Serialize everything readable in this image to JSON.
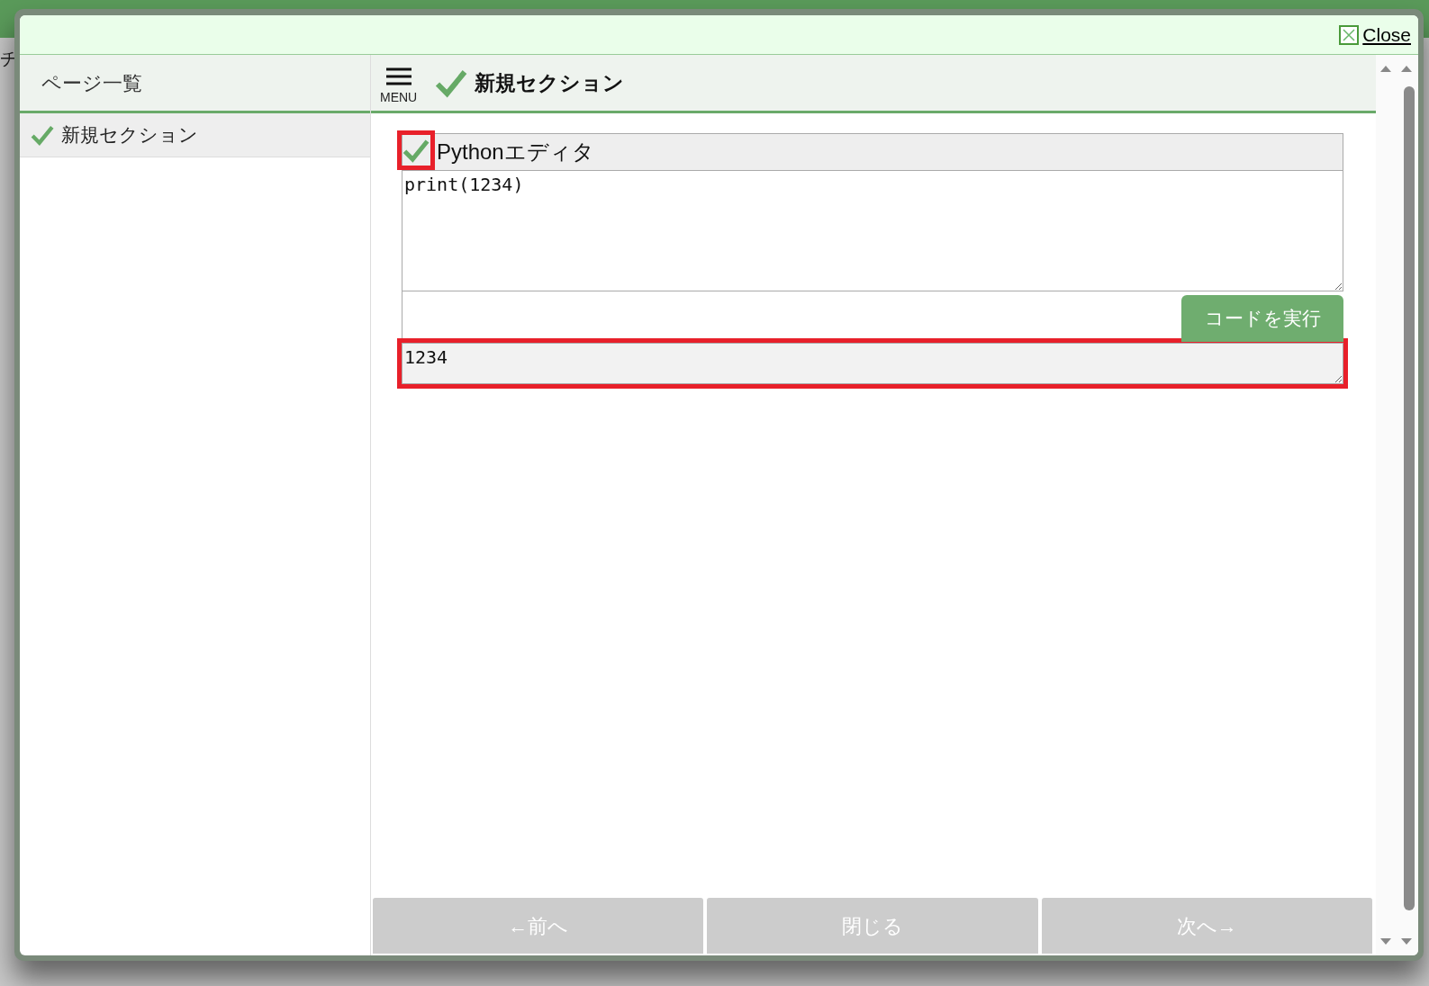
{
  "background": {
    "text": "チ"
  },
  "dialog": {
    "close": "Close"
  },
  "sidebar": {
    "title": "ページ一覧",
    "items": [
      {
        "label": "新規セクション",
        "completed": true,
        "selected": true
      }
    ]
  },
  "header": {
    "menu": "MENU",
    "title": "新規セクション",
    "completed": true
  },
  "editor": {
    "title": "Pythonエディタ",
    "completed": true,
    "highlighted": true,
    "code": "print(1234)",
    "run_button": "コードを実行",
    "output": "1234",
    "output_highlighted": true
  },
  "nav": [
    "←前へ",
    "閉じる",
    "次へ→"
  ]
}
